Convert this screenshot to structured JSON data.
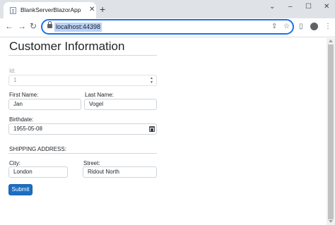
{
  "browser": {
    "tab_title": "BlankServerBlazorApp",
    "tab_close": "✕",
    "new_tab": "+",
    "window_controls": {
      "minimize": "–",
      "maximize": "☐",
      "close": "✕",
      "tab_search": "⌄"
    },
    "nav": {
      "back": "←",
      "forward": "→",
      "reload": "↻"
    },
    "url": "localhost:44398",
    "omnibox_icons": {
      "share": "⇪",
      "bookmark": "☆"
    },
    "toolbar_icons": {
      "side_panel": "▯",
      "menu": "⋮"
    }
  },
  "form": {
    "title": "Customer Information",
    "id_label": "Id:",
    "id_value": "1",
    "first_name_label": "First Name:",
    "first_name_value": "Jan",
    "last_name_label": "Last Name:",
    "last_name_value": "Vogel",
    "birthdate_label": "Birthdate:",
    "birthdate_value": "1955-05-08",
    "shipping_heading": "SHIPPING ADDRESS:",
    "city_label": "City:",
    "city_value": "London",
    "street_label": "Street:",
    "street_value": "Ridout North",
    "submit_label": "Submit",
    "spin_up": "▲",
    "spin_down": "▼"
  },
  "colors": {
    "accent": "#1a73e8",
    "primary_button": "#1b6ec2",
    "tab_strip": "#dfe3e8",
    "url_highlight": "#b9d2f8"
  }
}
